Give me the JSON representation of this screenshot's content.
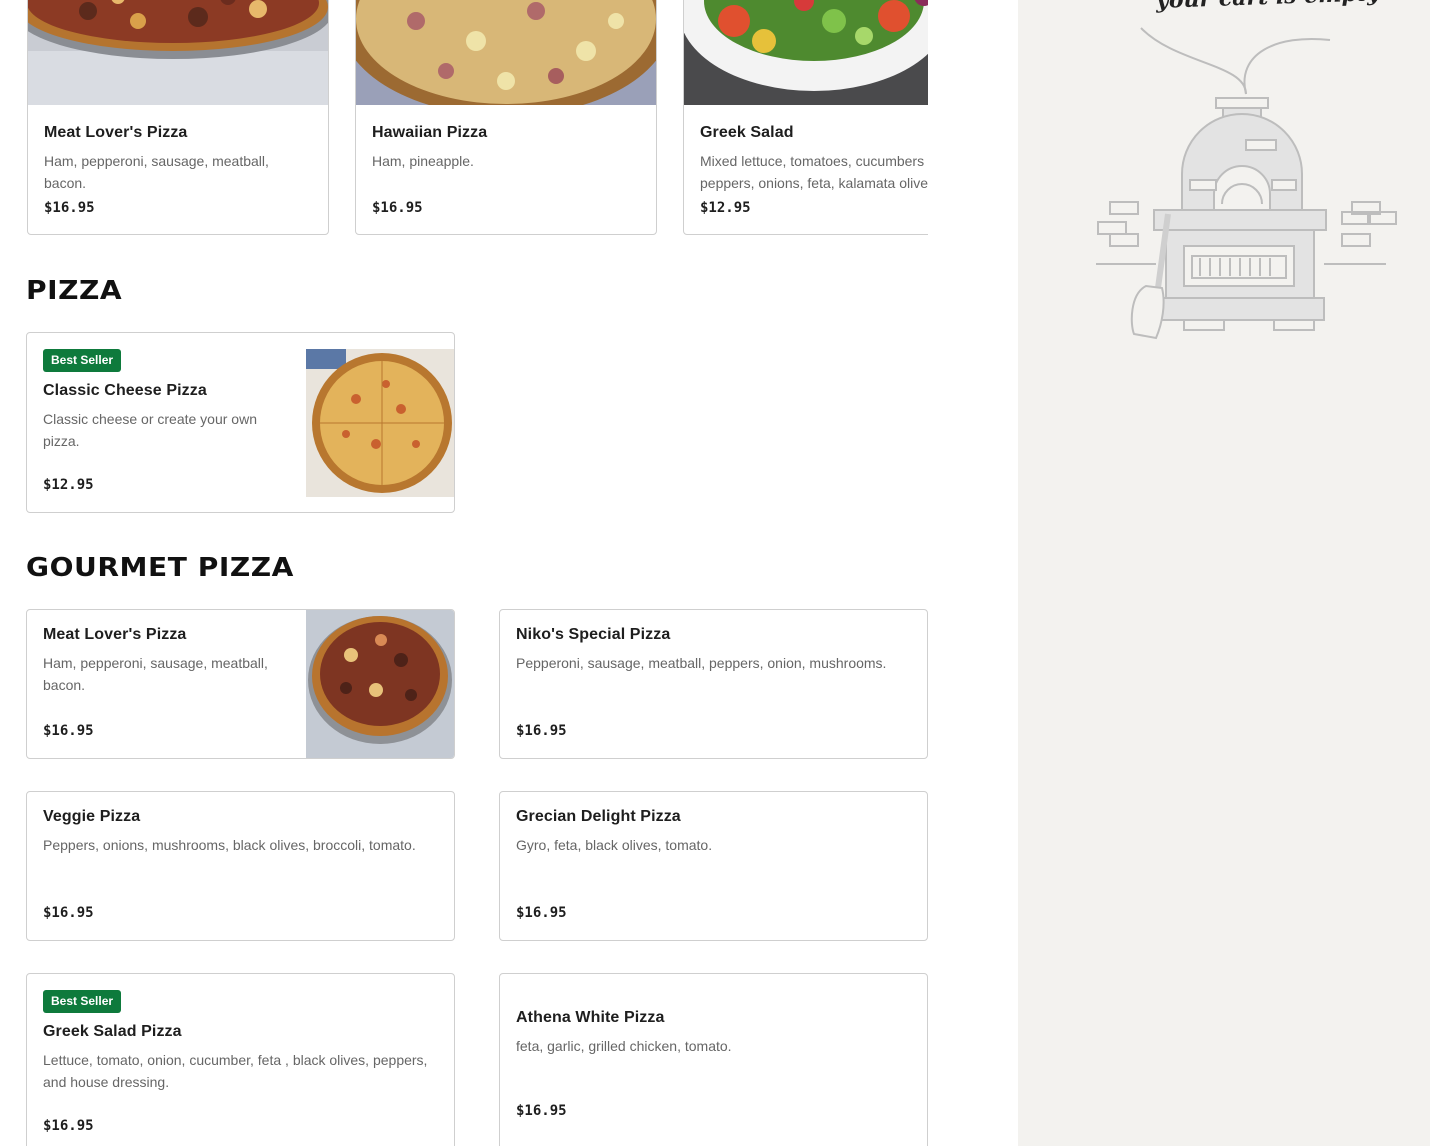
{
  "featured": [
    {
      "name": "Meat Lover's Pizza",
      "description": "Ham, pepperoni, sausage, meatball, bacon.",
      "price": "$16.95",
      "image": "meat-pizza-photo"
    },
    {
      "name": "Hawaiian Pizza",
      "description": "Ham, pineapple.",
      "price": "$16.95",
      "image": "hawaiian-pizza-photo"
    },
    {
      "name": "Greek Salad",
      "description_line1": "Mixed lettuce, tomatoes, cucumbers",
      "description_line2": "peppers, onions, feta, kalamata olive",
      "price": "$12.95",
      "image": "greek-salad-photo"
    }
  ],
  "sections": {
    "pizza": {
      "title": "PIZZA",
      "items": [
        {
          "badge": "Best Seller",
          "name": "Classic Cheese Pizza",
          "description": "Classic cheese or create your own pizza.",
          "price": "$12.95",
          "image": "cheese-pizza-photo"
        }
      ]
    },
    "gourmet": {
      "title": "GOURMET PIZZA",
      "items": [
        {
          "name": "Meat Lover's Pizza",
          "description": "Ham, pepperoni, sausage, meatball, bacon.",
          "price": "$16.95",
          "image": "meat-pizza-photo"
        },
        {
          "name": "Niko's Special Pizza",
          "description": "Pepperoni, sausage, meatball, peppers, onion, mushrooms.",
          "price": "$16.95"
        },
        {
          "name": "Veggie Pizza",
          "description": "Peppers, onions, mushrooms, black olives, broccoli, tomato.",
          "price": "$16.95"
        },
        {
          "name": "Grecian Delight Pizza",
          "description": "Gyro, feta, black olives, tomato.",
          "price": "$16.95"
        },
        {
          "badge": "Best Seller",
          "name": "Greek Salad Pizza",
          "description": "Lettuce, tomato, onion, cucumber, feta , black olives, peppers, and house dressing.",
          "price": "$16.95"
        },
        {
          "name": "Athena White Pizza",
          "description": "feta, garlic, grilled chicken, tomato.",
          "price": "$16.95"
        }
      ]
    }
  },
  "cart": {
    "empty_message": "your cart is empty",
    "illustration": "pizza-oven-illustration"
  },
  "colors": {
    "badge_green": "#0e7a3c",
    "cart_bg": "#f3f2ef",
    "border": "#cfcfcf"
  }
}
